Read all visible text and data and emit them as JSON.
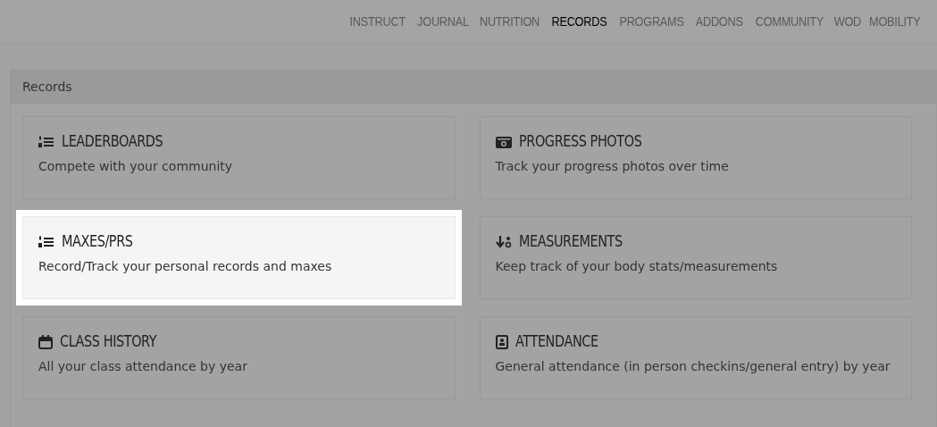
{
  "nav": [
    {
      "label": "INSTRUCT",
      "selected": false
    },
    {
      "label": "JOURNAL",
      "selected": false
    },
    {
      "label": "NUTRITION",
      "selected": false
    },
    {
      "label": "RECORDS",
      "selected": true
    },
    {
      "label": "PROGRAMS",
      "selected": false
    },
    {
      "label": "ADDONS",
      "selected": false
    },
    {
      "label": "COMMUNITY",
      "selected": false
    },
    {
      "label": "WOD",
      "selected": false
    },
    {
      "label": "MOBILITY",
      "selected": false
    }
  ],
  "panel": {
    "title": "Records"
  },
  "cards": [
    {
      "kind": "list",
      "title": "LEADERBOARDS",
      "description": "Compete with your community",
      "highlighted": false
    },
    {
      "kind": "camera",
      "title": "PROGRESS PHOTOS",
      "description": "Track your progress photos over time",
      "highlighted": false
    },
    {
      "kind": "list",
      "title": "MAXES/PRS",
      "description": "Record/Track your personal records and maxes",
      "highlighted": true
    },
    {
      "kind": "sort",
      "title": "MEASUREMENTS",
      "description": "Keep track of your body stats/measurements",
      "highlighted": false
    },
    {
      "kind": "calendar",
      "title": "CLASS HISTORY",
      "description": "All your class attendance by year",
      "highlighted": false
    },
    {
      "kind": "badge",
      "title": "ATTENDANCE",
      "description": "General attendance (in person checkins/general entry) by year",
      "highlighted": false
    }
  ]
}
